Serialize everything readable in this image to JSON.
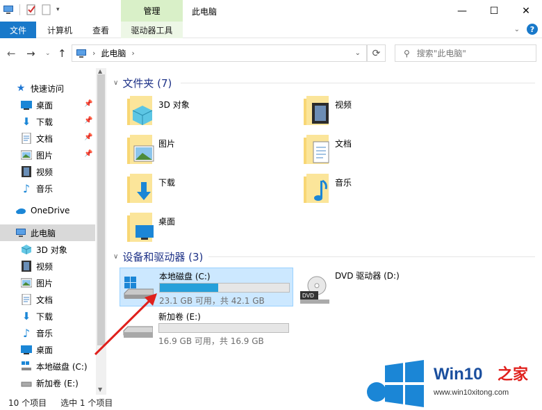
{
  "window": {
    "title": "此电脑",
    "context_tab_header": "管理"
  },
  "ribbon": {
    "tabs": [
      "文件",
      "计算机",
      "查看",
      "驱动器工具"
    ]
  },
  "address": {
    "path": "此电脑",
    "search_placeholder": "搜索\"此电脑\""
  },
  "nav": {
    "quick_access": "快速访问",
    "quick_items": [
      "桌面",
      "下载",
      "文档",
      "图片",
      "视频",
      "音乐"
    ],
    "onedrive": "OneDrive",
    "this_pc": "此电脑",
    "pc_items": [
      "3D 对象",
      "视频",
      "图片",
      "文档",
      "下载",
      "音乐",
      "桌面",
      "本地磁盘 (C:)",
      "新加卷 (E:)"
    ]
  },
  "content": {
    "folders_header": "文件夹 (7)",
    "folders": [
      "3D 对象",
      "视频",
      "图片",
      "文档",
      "下载",
      "音乐",
      "桌面"
    ],
    "drives_header": "设备和驱动器 (3)",
    "drives": [
      {
        "name": "本地磁盘 (C:)",
        "size": "23.1 GB 可用，共 42.1 GB",
        "used_fraction": 0.45
      },
      {
        "name": "新加卷 (E:)",
        "size": "16.9 GB 可用，共 16.9 GB",
        "used_fraction": 0.0
      },
      {
        "name": "DVD 驱动器 (D:)",
        "label": "DVD"
      }
    ]
  },
  "status": {
    "count": "10 个项目",
    "selected": "选中 1 个项目"
  },
  "watermark": {
    "brand": "Win10",
    "suffix": "之家",
    "url": "www.win10xitong.com"
  },
  "colors": {
    "file_tab": "#1979ca",
    "accent": "#26a0da",
    "selection": "#cce8ff",
    "folder": "#f8d775",
    "header_text": "#1e3287"
  }
}
